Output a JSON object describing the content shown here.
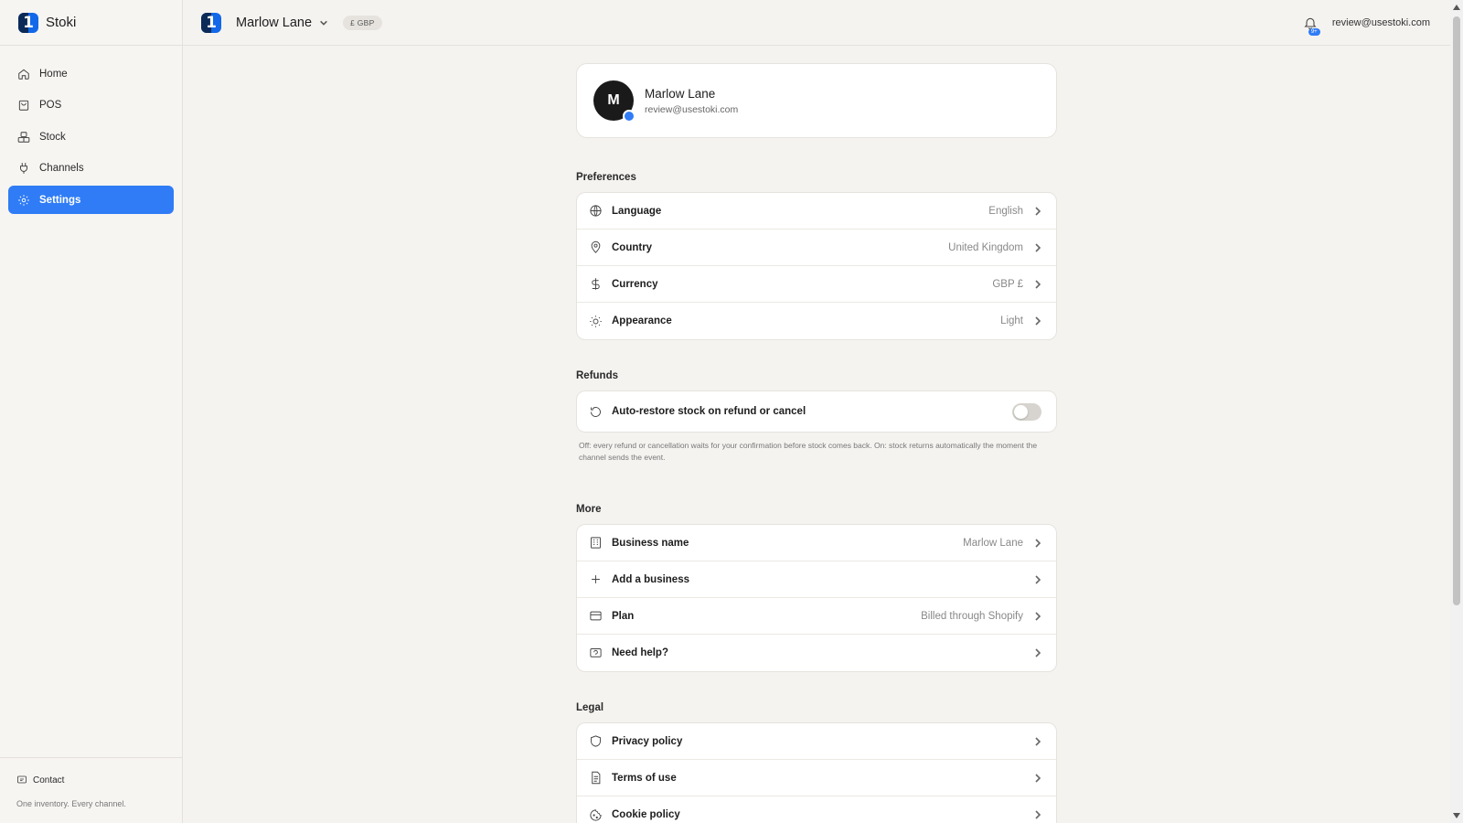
{
  "app": {
    "name": "Stoki",
    "tagline": "One inventory. Every channel."
  },
  "sidebar": {
    "items": [
      {
        "label": "Home",
        "icon": "home-icon"
      },
      {
        "label": "POS",
        "icon": "bag-icon"
      },
      {
        "label": "Stock",
        "icon": "boxes-icon"
      },
      {
        "label": "Channels",
        "icon": "plug-icon"
      },
      {
        "label": "Settings",
        "icon": "gear-icon",
        "active": true
      }
    ],
    "contact": "Contact"
  },
  "topbar": {
    "store_name": "Marlow Lane",
    "currency_badge": "£ GBP",
    "notification_badge": "9+",
    "user_email": "review@usestoki.com"
  },
  "profile": {
    "initial": "M",
    "name": "Marlow Lane",
    "email": "review@usestoki.com"
  },
  "preferences": {
    "title": "Preferences",
    "rows": [
      {
        "label": "Language",
        "value": "English",
        "icon": "globe-icon"
      },
      {
        "label": "Country",
        "value": "United Kingdom",
        "icon": "map-pin-icon"
      },
      {
        "label": "Currency",
        "value": "GBP £",
        "icon": "dollar-icon"
      },
      {
        "label": "Appearance",
        "value": "Light",
        "icon": "sun-icon"
      }
    ]
  },
  "refunds": {
    "title": "Refunds",
    "toggle_label": "Auto-restore stock on refund or cancel",
    "toggle_on": false,
    "note": "Off: every refund or cancellation waits for your confirmation before stock comes back. On: stock returns automatically the moment the channel sends the event."
  },
  "more": {
    "title": "More",
    "rows": [
      {
        "label": "Business name",
        "value": "Marlow Lane",
        "icon": "building-icon"
      },
      {
        "label": "Add a business",
        "value": "",
        "icon": "plus-icon"
      },
      {
        "label": "Plan",
        "value": "Billed through Shopify",
        "icon": "card-icon"
      },
      {
        "label": "Need help?",
        "value": "",
        "icon": "chat-icon"
      }
    ]
  },
  "legal": {
    "title": "Legal",
    "rows": [
      {
        "label": "Privacy policy",
        "icon": "shield-icon"
      },
      {
        "label": "Terms of use",
        "icon": "document-icon"
      },
      {
        "label": "Cookie policy",
        "icon": "cookie-icon"
      }
    ]
  },
  "colors": {
    "accent": "#2f7cf6",
    "background": "#f5f3f0",
    "card": "#ffffff"
  }
}
